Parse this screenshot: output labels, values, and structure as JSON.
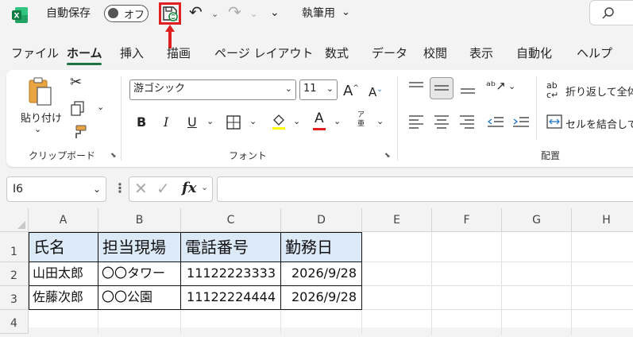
{
  "titlebar": {
    "autosave_label": "自動保存",
    "autosave_state": "オフ",
    "style_name": "執筆用"
  },
  "tabs": [
    {
      "label": "ファイル"
    },
    {
      "label": "ホーム"
    },
    {
      "label": "挿入"
    },
    {
      "label": "描画"
    },
    {
      "label": "ページ レイアウト"
    },
    {
      "label": "数式"
    },
    {
      "label": "データ"
    },
    {
      "label": "校閲"
    },
    {
      "label": "表示"
    },
    {
      "label": "自動化"
    },
    {
      "label": "ヘルプ"
    }
  ],
  "ribbon": {
    "clipboard": {
      "paste_label": "貼り付け",
      "group_label": "クリップボード"
    },
    "font": {
      "font_name": "游ゴシック",
      "font_size": "11",
      "group_label": "フォント",
      "bold": "B",
      "italic": "I",
      "underline": "U"
    },
    "alignment": {
      "wrap_text": "折り返して全体",
      "merge_center": "セルを結合して",
      "group_label": "配置"
    }
  },
  "formula_bar": {
    "name_box": "I6",
    "fx": "fx",
    "formula": ""
  },
  "sheet": {
    "columns": [
      "A",
      "B",
      "C",
      "D",
      "E",
      "F",
      "G",
      "H"
    ],
    "rows": [
      "1",
      "2",
      "3",
      "4"
    ],
    "data": [
      [
        "氏名",
        "担当現場",
        "電話番号",
        "勤務日"
      ],
      [
        "山田太郎",
        "〇〇タワー",
        "11122223333",
        "2026/9/28"
      ],
      [
        "佐藤次郎",
        "〇〇公園",
        "11122224444",
        "2026/9/28"
      ]
    ]
  },
  "colors": {
    "accent": "#217346",
    "highlight": "#e02020",
    "header_fill": "#dce9f7"
  }
}
